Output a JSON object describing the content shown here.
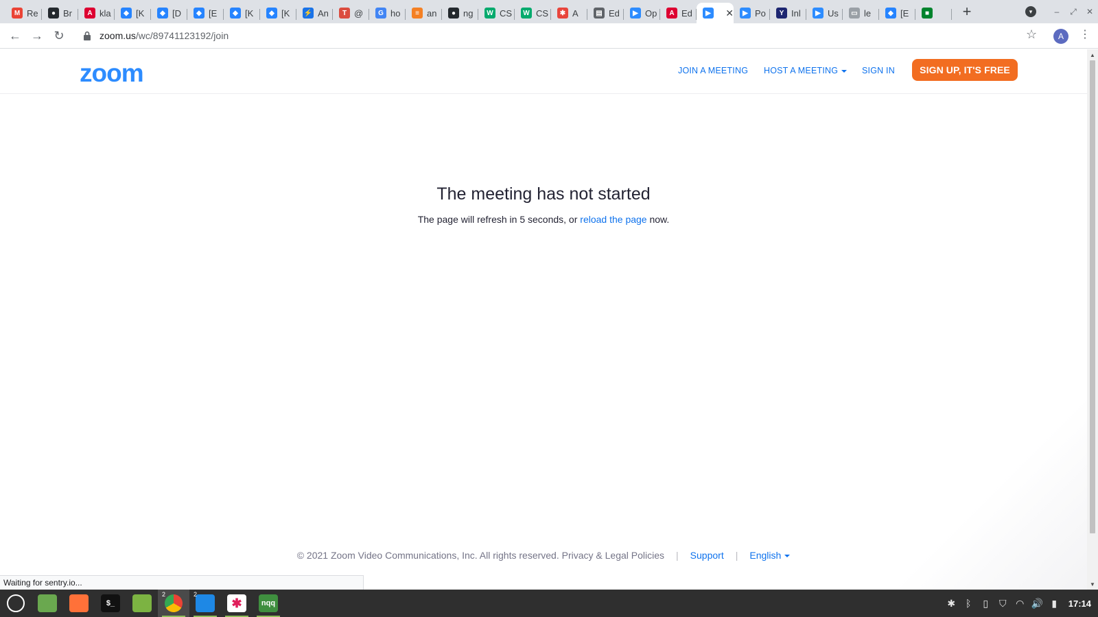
{
  "browser": {
    "tabs": [
      {
        "label": "Re",
        "icon": "gmail-icon",
        "color": "#ea4335",
        "glyph": "M"
      },
      {
        "label": "Br",
        "icon": "github-icon",
        "color": "#24292e",
        "glyph": "●"
      },
      {
        "label": "kla",
        "icon": "angular-icon",
        "color": "#dd0031",
        "glyph": "A"
      },
      {
        "label": "[K",
        "icon": "jira-icon",
        "color": "#2684ff",
        "glyph": "◆"
      },
      {
        "label": "[D",
        "icon": "jira-icon",
        "color": "#2684ff",
        "glyph": "◆"
      },
      {
        "label": "[E",
        "icon": "jira-icon",
        "color": "#2684ff",
        "glyph": "◆"
      },
      {
        "label": "[K",
        "icon": "jira-icon",
        "color": "#2684ff",
        "glyph": "◆"
      },
      {
        "label": "[K",
        "icon": "jira-icon",
        "color": "#2684ff",
        "glyph": "◆"
      },
      {
        "label": "An",
        "icon": "bolt-icon",
        "color": "#1a73e8",
        "glyph": "⚡"
      },
      {
        "label": "@",
        "icon": "todoist-icon",
        "color": "#db4c3f",
        "glyph": "T"
      },
      {
        "label": "ho",
        "icon": "google-icon",
        "color": "#4285f4",
        "glyph": "G"
      },
      {
        "label": "an",
        "icon": "stackoverflow-icon",
        "color": "#f48024",
        "glyph": "≡"
      },
      {
        "label": "ng",
        "icon": "github-icon",
        "color": "#24292e",
        "glyph": "●"
      },
      {
        "label": "CS",
        "icon": "w3schools-icon",
        "color": "#04aa6d",
        "glyph": "W"
      },
      {
        "label": "CS",
        "icon": "w3schools-icon",
        "color": "#04aa6d",
        "glyph": "W"
      },
      {
        "label": "A",
        "icon": "asterisk-icon",
        "color": "#e8453c",
        "glyph": "✱"
      },
      {
        "label": "Ed",
        "icon": "doc-icon",
        "color": "#5f6368",
        "glyph": "▤"
      },
      {
        "label": "Op",
        "icon": "zoom-icon",
        "color": "#2d8cff",
        "glyph": "▶"
      },
      {
        "label": "Ed",
        "icon": "angular-icon",
        "color": "#dd0031",
        "glyph": "A"
      },
      {
        "label": "",
        "icon": "zoom-icon",
        "color": "#2d8cff",
        "glyph": "▶",
        "active": true
      },
      {
        "label": "Po",
        "icon": "zoom-icon",
        "color": "#2d8cff",
        "glyph": "▶"
      },
      {
        "label": "Inl",
        "icon": "yc-icon",
        "color": "#1d2671",
        "glyph": "Y"
      },
      {
        "label": "Us",
        "icon": "zoom-icon",
        "color": "#2d8cff",
        "glyph": "▶"
      },
      {
        "label": "le",
        "icon": "page-icon",
        "color": "#9aa0a6",
        "glyph": "▭"
      },
      {
        "label": "[E",
        "icon": "jira-icon",
        "color": "#2684ff",
        "glyph": "◆"
      },
      {
        "label": "",
        "icon": "meet-icon",
        "color": "#00832d",
        "glyph": "■"
      }
    ],
    "url_host": "zoom.us",
    "url_path": "/wc/89741123192/join",
    "profile_initial": "A",
    "status_text": "Waiting for sentry.io..."
  },
  "zoom": {
    "logo": "zoom",
    "nav": {
      "join": "JOIN A MEETING",
      "host": "HOST A MEETING",
      "signin": "SIGN IN",
      "signup": "SIGN UP, IT'S FREE"
    },
    "message": {
      "title": "The meeting has not started",
      "prefix": "The page will refresh in 5 seconds, or ",
      "link": "reload the page",
      "suffix": " now."
    },
    "footer": {
      "copyright": "© 2021 Zoom Video Communications, Inc. All rights reserved.",
      "privacy": "Privacy & Legal Policies",
      "support": "Support",
      "language": "English"
    },
    "colors": {
      "brand": "#2d8cff",
      "link": "#0e72ed",
      "signup": "#f26d21"
    }
  },
  "taskbar": {
    "apps": [
      {
        "name": "mint-menu-icon",
        "label": "",
        "color": "#2f2f2f"
      },
      {
        "name": "show-desktop-icon",
        "label": "",
        "color": "#6aa84f"
      },
      {
        "name": "firefox-icon",
        "label": "",
        "color": "#ff7139"
      },
      {
        "name": "terminal-icon",
        "label": "$_",
        "color": "#111111"
      },
      {
        "name": "files-icon",
        "label": "",
        "color": "#7cb342"
      },
      {
        "name": "chrome-icon",
        "label": "",
        "color": "#4285f4",
        "badge": "2",
        "active": true
      },
      {
        "name": "vscode-icon",
        "label": "",
        "color": "#1e88e5",
        "badge": "2"
      },
      {
        "name": "slack-icon",
        "label": "",
        "color": "#ffffff"
      },
      {
        "name": "nqq-icon",
        "label": "nqq",
        "color": "#3f8f3f"
      }
    ],
    "time": "17:14"
  }
}
